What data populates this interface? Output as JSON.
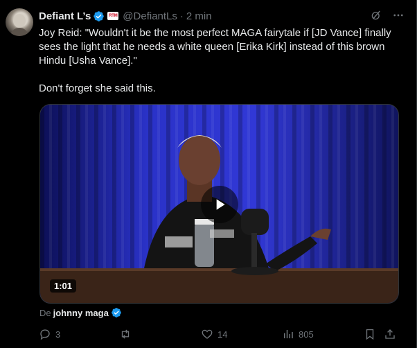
{
  "author": {
    "name": "Defiant L’s",
    "affiliate_badge": "RTM",
    "handle": "@DefiantLs",
    "separator": "·",
    "time": "2 min"
  },
  "tweet": {
    "line1": "Joy Reid: \"Wouldn't it be the most perfect MAGA fairytale if [JD Vance] finally sees the light that he needs a white queen [Erika Kirk] instead of this brown Hindu [Usha Vance].\"",
    "line2": "Don't forget she said this."
  },
  "media": {
    "duration": "1:01"
  },
  "source": {
    "prefix": "De",
    "name": "johnny maga"
  },
  "actions": {
    "replies": "3",
    "reposts": "",
    "likes": "14",
    "views": "805"
  },
  "colors": {
    "verified": "#1d9bf0",
    "muted": "#71767b",
    "text": "#e7e9ea",
    "background": "#000000"
  },
  "icons": [
    "grok-icon",
    "more-icon",
    "reply-icon",
    "repost-icon",
    "like-icon",
    "views-icon",
    "bookmark-icon",
    "share-icon",
    "play-icon"
  ]
}
